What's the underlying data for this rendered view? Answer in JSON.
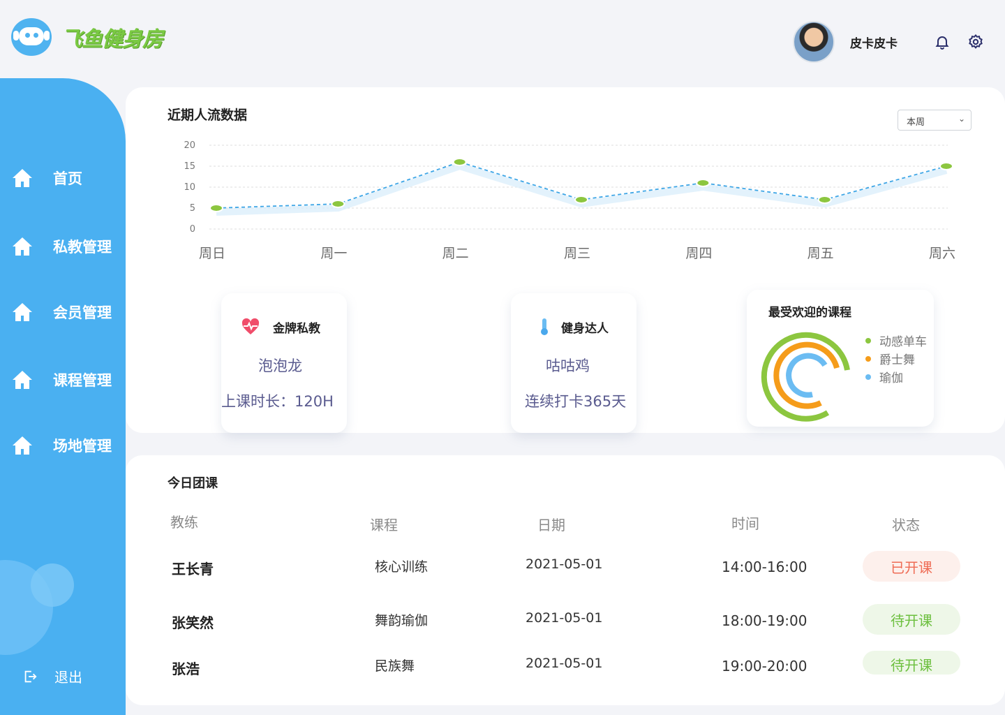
{
  "app": {
    "logo_text": "飞鱼健身房"
  },
  "header": {
    "username": "皮卡皮卡"
  },
  "sidebar": {
    "items": [
      {
        "label": "首页"
      },
      {
        "label": "私教管理"
      },
      {
        "label": "会员管理"
      },
      {
        "label": "课程管理"
      },
      {
        "label": "场地管理"
      }
    ],
    "logout_label": "退出"
  },
  "traffic": {
    "title": "近期人流数据",
    "period_select": "本周",
    "chart_data": {
      "type": "line",
      "categories": [
        "周日",
        "周一",
        "周二",
        "周三",
        "周四",
        "周五",
        "周六"
      ],
      "values": [
        5,
        6,
        16,
        7,
        11,
        7,
        15
      ],
      "y_ticks": [
        "0",
        "5",
        "10",
        "15",
        "20"
      ],
      "ylim": [
        0,
        20
      ],
      "grid": true,
      "colors": {
        "line": "#3ea6e6",
        "point": "#8cc63f"
      }
    }
  },
  "stats": {
    "gold_trainer": {
      "label": "金牌私教",
      "name": "泡泡龙",
      "detail": "上课时长：120H"
    },
    "fitness_star": {
      "label": "健身达人",
      "name": "咕咕鸡",
      "detail": "连续打卡365天"
    },
    "popular_courses": {
      "title": "最受欢迎的课程",
      "legend": [
        {
          "name": "动感单车",
          "color": "#8cc63f"
        },
        {
          "name": "爵士舞",
          "color": "#f59c1a"
        },
        {
          "name": "瑜伽",
          "color": "#6bbcf2"
        }
      ]
    }
  },
  "classes": {
    "title": "今日团课",
    "headers": {
      "coach": "教练",
      "course": "课程",
      "date": "日期",
      "time": "时间",
      "status": "状态"
    },
    "rows": [
      {
        "coach": "王长青",
        "course": "核心训练",
        "date": "2021-05-01",
        "time": "14:00-16:00",
        "status": "已开课"
      },
      {
        "coach": "张笑然",
        "course": "舞韵瑜伽",
        "date": "2021-05-01",
        "time": "18:00-19:00",
        "status": "待开课"
      },
      {
        "coach": "张浩",
        "course": "民族舞",
        "date": "2021-05-01",
        "time": "19:00-20:00",
        "status": "待开课"
      }
    ]
  }
}
